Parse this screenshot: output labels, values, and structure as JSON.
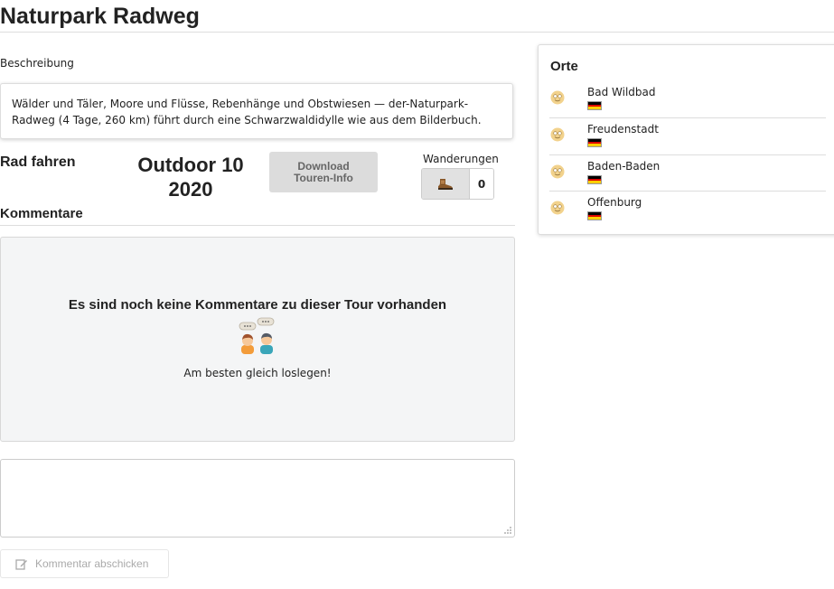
{
  "page": {
    "title": "Naturpark Radweg"
  },
  "description": {
    "label": "Beschreibung",
    "text": "Wälder und Täler, Moore und Flüsse, Rebenhänge und Obstwiesen — der-Naturpark-Radweg (4 Tage, 260 km) führt durch eine Schwarzwaldidylle wie aus dem Bilderbuch."
  },
  "tour": {
    "category": "Rad fahren",
    "outdoor_line1": "Outdoor 10",
    "outdoor_line2": "2020",
    "download_line1": "Download",
    "download_line2": "Touren-Info",
    "hike_label": "Wanderungen",
    "hike_count": "0",
    "hike_icon": "hiking-boot-icon"
  },
  "comments": {
    "title": "Kommentare",
    "empty_title": "Es sind noch keine Kommentare zu dieser Tour vorhanden",
    "empty_subtitle": "Am besten gleich loslegen!",
    "input_value": "",
    "submit_label": "Kommentar abschicken",
    "submit_icon": "edit-icon"
  },
  "places": {
    "title": "Orte",
    "items": [
      {
        "name": "Bad Wildbad",
        "icon": "smiley-icon",
        "flag": "germany-flag-icon"
      },
      {
        "name": "Freudenstadt",
        "icon": "smiley-icon",
        "flag": "germany-flag-icon"
      },
      {
        "name": "Baden-Baden",
        "icon": "smiley-icon",
        "flag": "germany-flag-icon"
      },
      {
        "name": "Offenburg",
        "icon": "smiley-icon",
        "flag": "germany-flag-icon"
      }
    ]
  },
  "colors": {
    "flag_black": "#000000",
    "flag_red": "#dd0000",
    "flag_gold": "#ffce00",
    "disabled_text": "#aaaaaa"
  }
}
